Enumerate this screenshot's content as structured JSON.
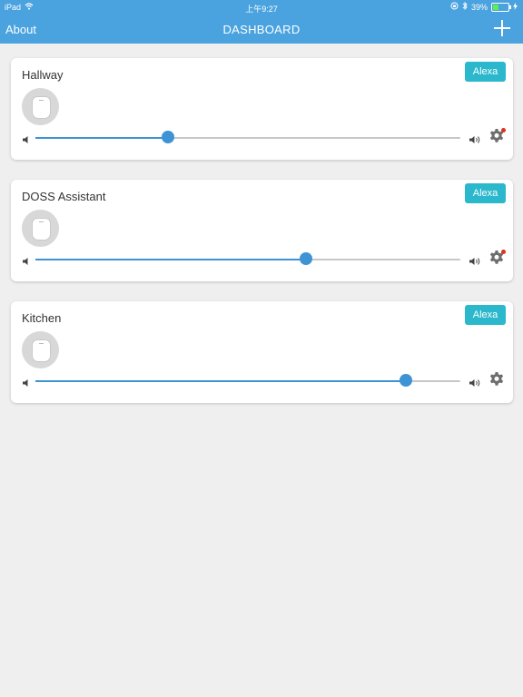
{
  "status_bar": {
    "device": "iPad",
    "time": "上午9:27",
    "battery": "39%",
    "battery_level": 0.39
  },
  "nav": {
    "about_label": "About",
    "title": "DASHBOARD",
    "add_icon": "plus-icon"
  },
  "colors": {
    "header": "#4aa3df",
    "accent": "#3e93d4",
    "alexa_badge": "#2bb7cc",
    "notification_dot": "#e0301e"
  },
  "speakers": [
    {
      "name": "Hallway",
      "badge": "Alexa",
      "volume": 0.313,
      "settings_alert": true
    },
    {
      "name": "DOSS Assistant",
      "badge": "Alexa",
      "volume": 0.637,
      "settings_alert": true
    },
    {
      "name": "Kitchen",
      "badge": "Alexa",
      "volume": 0.871,
      "settings_alert": false
    }
  ]
}
